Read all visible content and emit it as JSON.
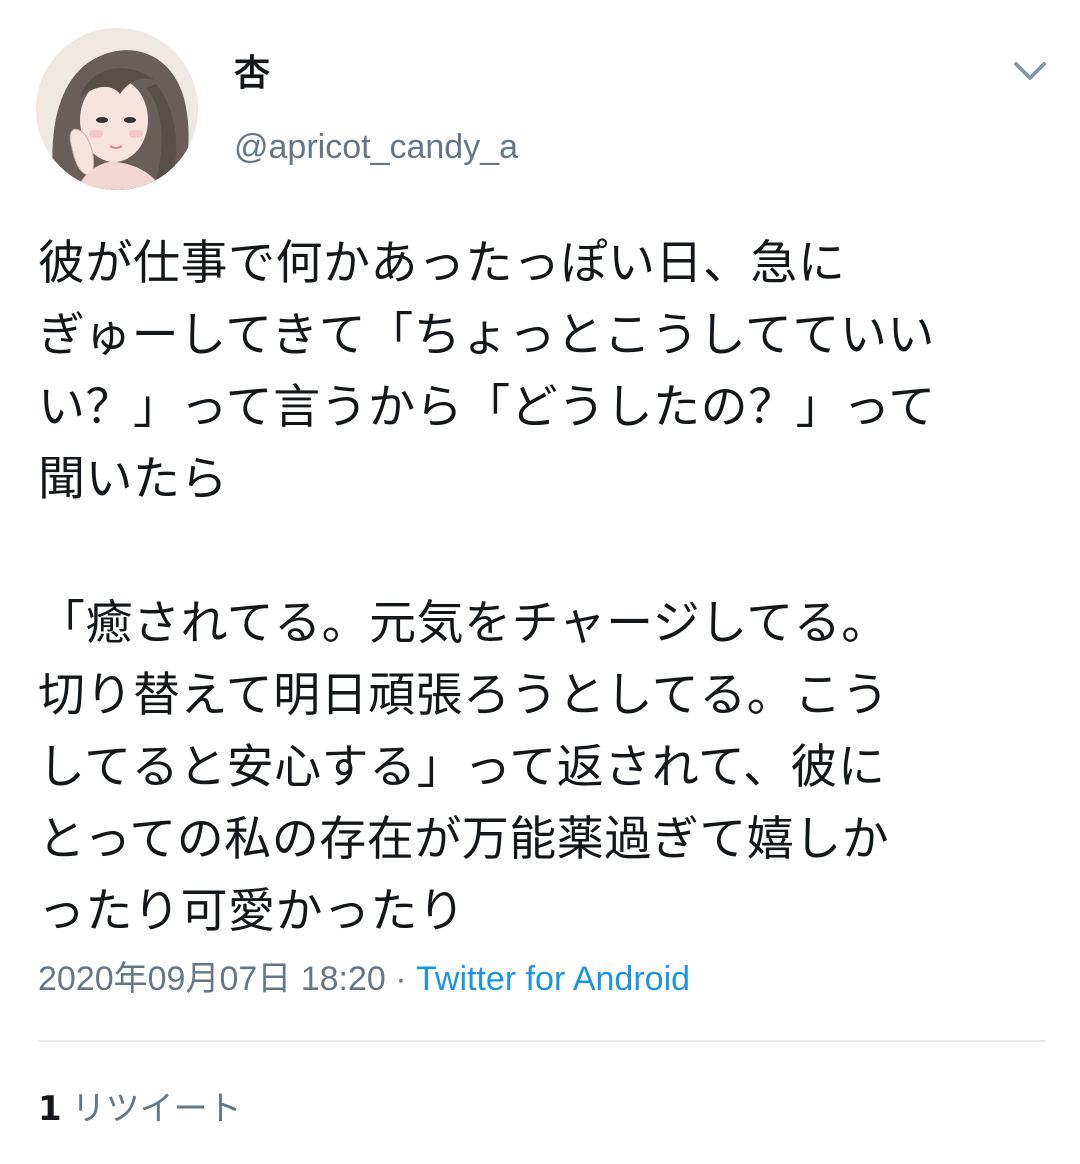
{
  "user": {
    "display_name": "杏",
    "handle": "@apricot_candy_a",
    "avatar_icon": "profile-illustration-avatar"
  },
  "menu": {
    "icon": "chevron-down-icon"
  },
  "tweet": {
    "paragraph1": [
      "彼が仕事で何かあったっぽい日、急に",
      "ぎゅーしてきて「ちょっとこうしてていい",
      "い？」って言うから「どうしたの？」って",
      "聞いたら"
    ],
    "paragraph2": [
      "「癒されてる。元気をチャージしてる。",
      "切り替えて明日頑張ろうとしてる。こう",
      "してると安心する」って返されて、彼に",
      "とっての私の存在が万能薬過ぎて嬉しか",
      "ったり可愛かったり"
    ]
  },
  "meta": {
    "timestamp": "2020年09月07日 18:20",
    "separator": " · ",
    "source": "Twitter for Android"
  },
  "stats": {
    "retweet_count": "1",
    "retweet_label": "リツイート"
  },
  "colors": {
    "text": "#14171a",
    "secondary": "#657786",
    "link": "#1b95e0",
    "divider": "#e6ecf0"
  }
}
